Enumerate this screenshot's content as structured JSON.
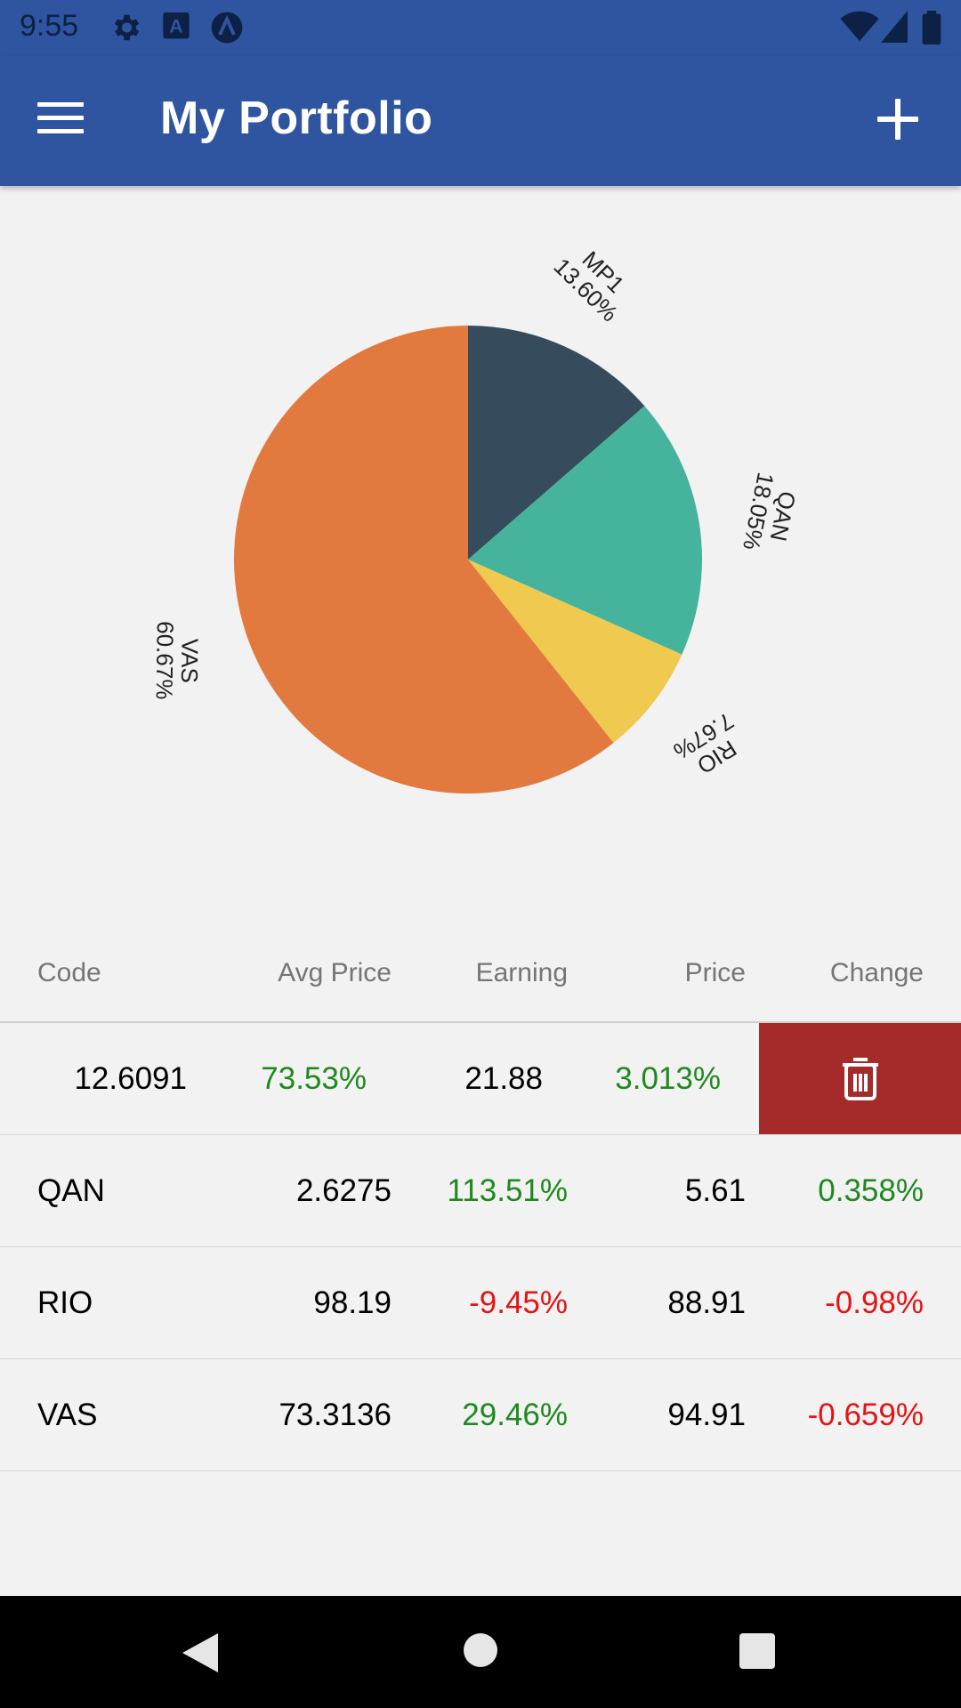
{
  "status_bar": {
    "time": "9:55",
    "left_icons": [
      "gear-icon",
      "text-a-icon",
      "app-circle-icon"
    ],
    "right_icons": [
      "wifi-icon",
      "signal-icon",
      "battery-icon"
    ]
  },
  "app_bar": {
    "title": "My Portfolio",
    "menu_icon": "menu-icon",
    "add_icon": "add-icon"
  },
  "chart_data": {
    "type": "pie",
    "slices": [
      {
        "label": "MP1",
        "percent_label": "13.60%",
        "value": 13.6,
        "color": "#364c5d"
      },
      {
        "label": "QAN",
        "percent_label": "18.05%",
        "value": 18.05,
        "color": "#46b39d"
      },
      {
        "label": "RIO",
        "percent_label": "7.67%",
        "value": 7.67,
        "color": "#f0c94f"
      },
      {
        "label": "VAS",
        "percent_label": "60.67%",
        "value": 60.67,
        "color": "#e27a40"
      }
    ]
  },
  "table": {
    "headers": {
      "code": "Code",
      "avg_price": "Avg Price",
      "earning": "Earning",
      "price": "Price",
      "change": "Change"
    },
    "rows": [
      {
        "code": "",
        "avg_price": "12.6091",
        "earning": "73.53%",
        "earning_sign": "pos",
        "price": "21.88",
        "change": "3.013%",
        "change_sign": "pos",
        "swiped": true
      },
      {
        "code": "QAN",
        "avg_price": "2.6275",
        "earning": "113.51%",
        "earning_sign": "pos",
        "price": "5.61",
        "change": "0.358%",
        "change_sign": "pos"
      },
      {
        "code": "RIO",
        "avg_price": "98.19",
        "earning": "-9.45%",
        "earning_sign": "neg",
        "price": "88.91",
        "change": "-0.98%",
        "change_sign": "neg"
      },
      {
        "code": "VAS",
        "avg_price": "73.3136",
        "earning": "29.46%",
        "earning_sign": "pos",
        "price": "94.91",
        "change": "-0.659%",
        "change_sign": "neg"
      }
    ],
    "delete_icon": "trash-icon"
  },
  "nav_bar": {
    "icons": [
      "back-icon",
      "home-icon",
      "recents-icon"
    ]
  }
}
